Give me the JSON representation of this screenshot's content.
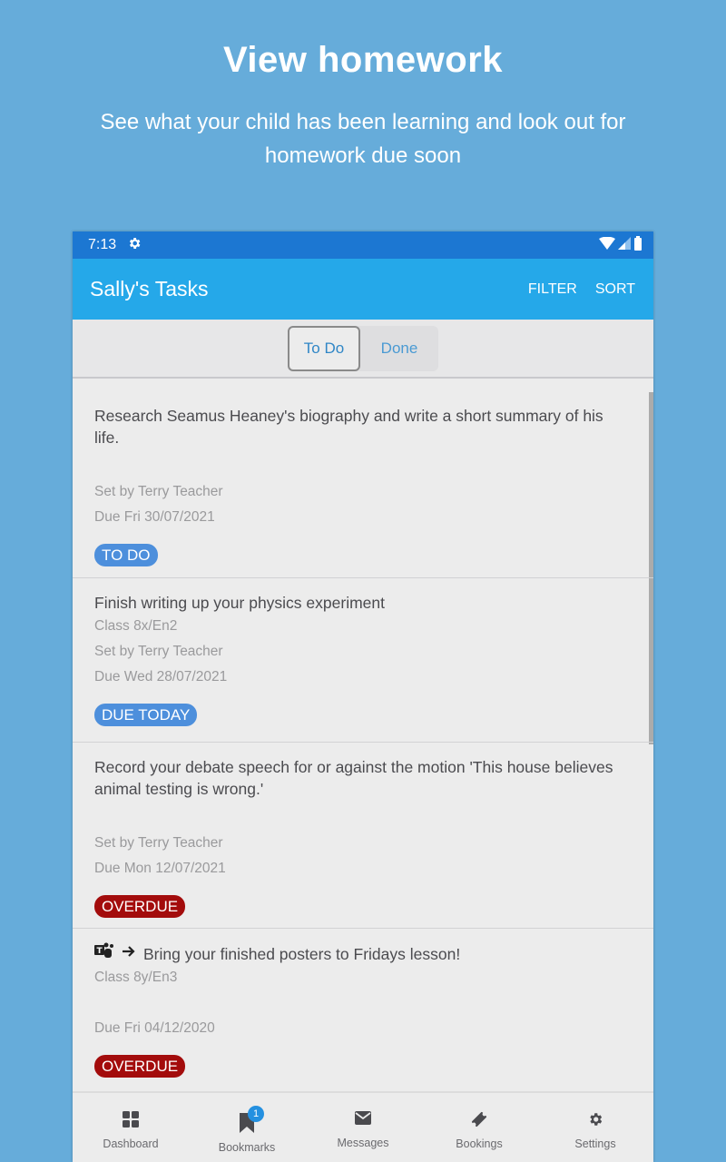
{
  "promo": {
    "title": "View homework",
    "subtitle": "See what your child has been learning and look out for homework due soon"
  },
  "statusbar": {
    "time": "7:13",
    "icons": [
      "gear-icon",
      "wifi-icon",
      "signal-icon",
      "battery-icon"
    ]
  },
  "appbar": {
    "title": "Sally's Tasks",
    "filter_label": "FILTER",
    "sort_label": "SORT"
  },
  "segment": {
    "todo_label": "To Do",
    "done_label": "Done",
    "selected": "To Do"
  },
  "tasks": [
    {
      "title": "Research Seamus Heaney's biography and write a short summary of his life.",
      "class": "",
      "set_by": "Set by Terry Teacher",
      "due": "Due Fri 30/07/2021",
      "badge": "TO DO",
      "badge_color": "#4d8fdc"
    },
    {
      "title": "Finish writing up your physics experiment",
      "class": "Class 8x/En2",
      "set_by": "Set by Terry Teacher",
      "due": "Due Wed 28/07/2021",
      "badge": "DUE TODAY",
      "badge_color": "#4d8fdc"
    },
    {
      "title": "Record your debate speech for or against the motion 'This house believes animal testing is wrong.'",
      "class": "",
      "set_by": "Set by Terry Teacher",
      "due": "Due Mon 12/07/2021",
      "badge": "OVERDUE",
      "badge_color": "#a30c0c"
    },
    {
      "title": "Bring your finished posters to Fridays lesson!",
      "class": "Class 8y/En3",
      "set_by": "",
      "due": "Due Fri 04/12/2020",
      "badge": "OVERDUE",
      "badge_color": "#a30c0c",
      "icons": [
        "teams-icon",
        "arrow-right-icon"
      ]
    }
  ],
  "nav": {
    "items": [
      {
        "label": "Dashboard",
        "icon": "grid-icon"
      },
      {
        "label": "Bookmarks",
        "icon": "bookmark-icon",
        "badge": "1"
      },
      {
        "label": "Messages",
        "icon": "envelope-icon"
      },
      {
        "label": "Bookings",
        "icon": "ticket-icon"
      },
      {
        "label": "Settings",
        "icon": "gear-icon"
      }
    ]
  },
  "colors": {
    "background": "#66acda",
    "statusbar": "#1c77d2",
    "appbar": "#25a8e9",
    "badge_blue": "#4d8fdc",
    "badge_red": "#a30c0c"
  }
}
